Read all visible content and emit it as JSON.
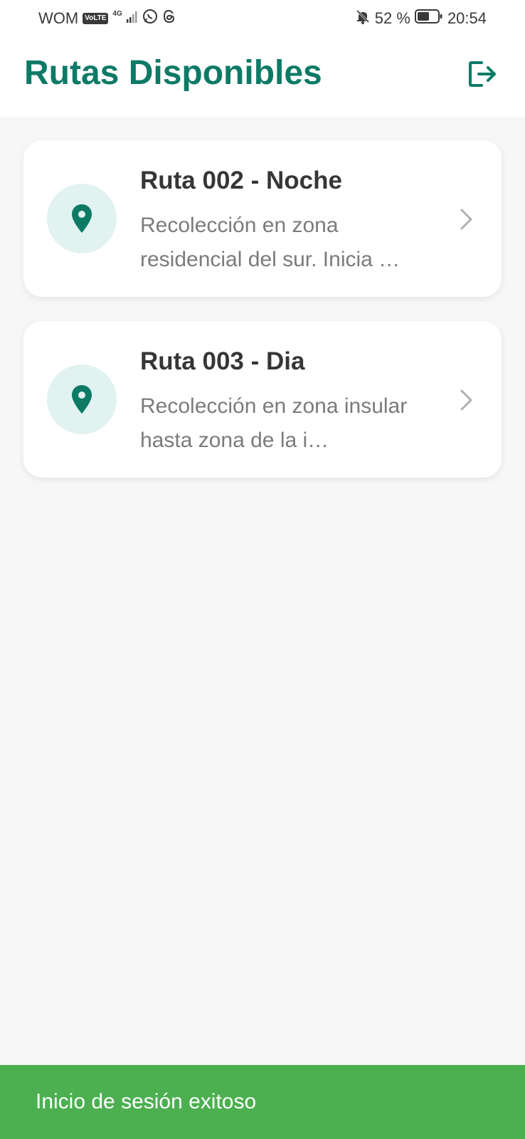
{
  "status_bar": {
    "carrier": "WOM",
    "volte": "VoLTE",
    "network_type": "4G",
    "battery_percent": "52 %",
    "time": "20:54",
    "icons": [
      "signal-icon",
      "whatsapp-icon",
      "threads-icon",
      "muted-bell-icon",
      "battery-icon"
    ]
  },
  "header": {
    "title": "Rutas Disponibles",
    "logout_icon": "logout-icon"
  },
  "routes": [
    {
      "name": "Ruta 002 - Noche",
      "description": "Recolección en zona residencial del sur. Inicia …",
      "icon": "location-pin-icon"
    },
    {
      "name": "Ruta 003 - Dia",
      "description": "Recolección en zona insular hasta zona de la i…",
      "icon": "location-pin-icon"
    }
  ],
  "snackbar": {
    "message": "Inicio de sesión exitoso"
  },
  "colors": {
    "primary": "#0d7a66",
    "icon_circle_bg": "#e1f2f1",
    "snackbar_bg": "#4caf50",
    "page_bg": "#f7f7f7"
  }
}
